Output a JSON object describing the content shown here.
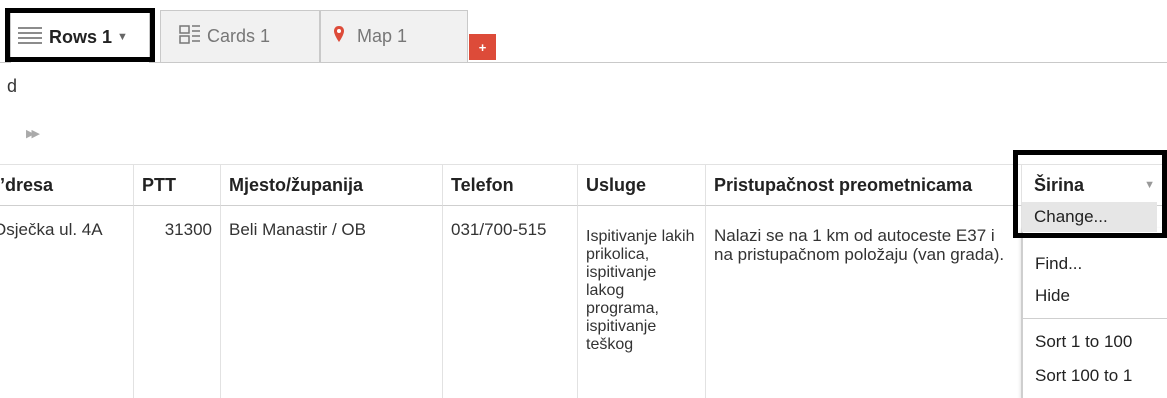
{
  "tabs": [
    {
      "label": "Rows 1",
      "icon": "rows-icon",
      "active": true
    },
    {
      "label": "Cards 1",
      "icon": "cards-icon",
      "active": false
    },
    {
      "label": "Map 1",
      "icon": "map-pin-icon",
      "active": false
    }
  ],
  "add_tab_label": "+",
  "fragment_text": "d",
  "forward_icon": "double-chevron-right-icon",
  "table": {
    "columns": [
      "’dresa",
      "PTT",
      "Mjesto/županija",
      "Telefon",
      "Usluge",
      "Pristupačnost preometnicama",
      "Širina"
    ],
    "row": {
      "adresa": "Osječka ul. 4A",
      "ptt": "31300",
      "mjesto": "Beli Manastir / OB",
      "telefon": "031/700-515",
      "usluge": "Ispitivanje lakih prikolica, ispitivanje lakog programa, ispitivanje teškog",
      "pristupacnost": "Nalazi se na 1 km od autoceste E37 i na pristupačnom položaju (van grada)."
    }
  },
  "column_menu": {
    "change": "Change...",
    "find": "Find...",
    "hide": "Hide",
    "sort_asc": "Sort 1 to 100",
    "sort_desc": "Sort 100 to 1"
  },
  "colors": {
    "accent": "#dd4b39",
    "pin": "#dd4b39"
  }
}
